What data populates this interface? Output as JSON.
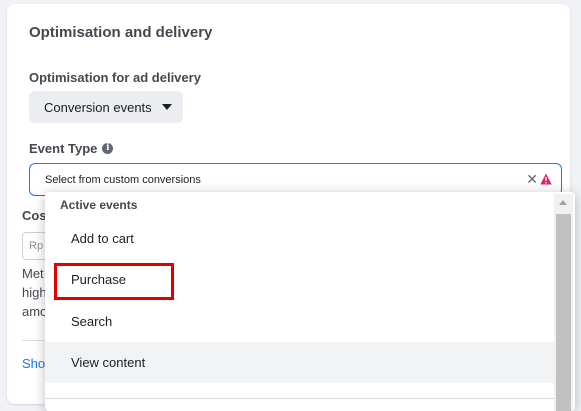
{
  "section": {
    "title": "Optimisation and delivery"
  },
  "optimisation": {
    "label": "Optimisation for ad delivery",
    "selected": "Conversion events"
  },
  "event_type": {
    "label": "Event Type",
    "info_icon": "info-icon",
    "placeholder": "Select from custom conversions",
    "clear_icon": "close-icon",
    "clear_glyph": "✕",
    "warning_icon": "warning-icon",
    "warning_color": "#e0245e"
  },
  "underlying": {
    "cost_label": "Cos",
    "cost_input_placeholder": "Rp",
    "description": [
      "Met",
      "high",
      "amo"
    ],
    "link": "Sho"
  },
  "menu": {
    "header": "Active events",
    "items": [
      {
        "label": "Add to cart",
        "hovered": false
      },
      {
        "label": "Purchase",
        "hovered": false
      },
      {
        "label": "Search",
        "hovered": false
      },
      {
        "label": "View content",
        "hovered": true
      }
    ]
  },
  "colors": {
    "accent": "#1877f2",
    "highlight_annotation": "#e00000"
  }
}
